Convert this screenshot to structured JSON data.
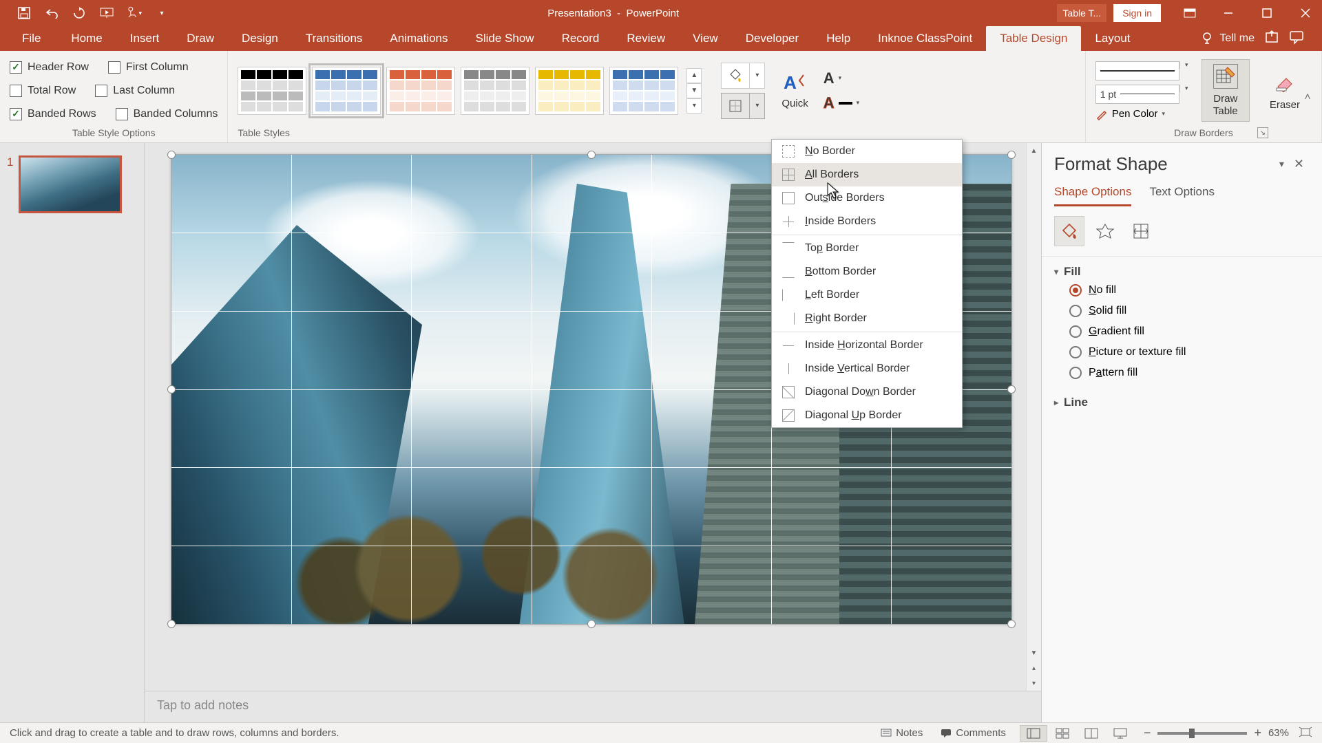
{
  "title": {
    "doc": "Presentation3",
    "app": "PowerPoint",
    "tool_tab": "Table T..."
  },
  "signin": "Sign in",
  "tabs": [
    "File",
    "Home",
    "Insert",
    "Draw",
    "Design",
    "Transitions",
    "Animations",
    "Slide Show",
    "Record",
    "Review",
    "View",
    "Developer",
    "Help",
    "Inknoe ClassPoint",
    "Table Design",
    "Layout"
  ],
  "tellme": "Tell me",
  "style_options": {
    "header_row": "Header Row",
    "total_row": "Total Row",
    "banded_rows": "Banded Rows",
    "first_column": "First Column",
    "last_column": "Last Column",
    "banded_columns": "Banded Columns",
    "group": "Table Style Options"
  },
  "table_styles_group": "Table Styles",
  "quick": "Quick",
  "draw_borders": {
    "pen_weight": "1 pt",
    "pen_color": "Pen Color",
    "draw_table": "Draw\nTable",
    "eraser": "Eraser",
    "group": "Draw Borders"
  },
  "borders_menu": {
    "no": "No Border",
    "all": "All Borders",
    "outside": "Outside Borders",
    "inside": "Inside Borders",
    "top": "Top Border",
    "bottom": "Bottom Border",
    "left": "Left Border",
    "right": "Right Border",
    "ins_h": "Inside Horizontal Border",
    "ins_v": "Inside Vertical Border",
    "diag_d": "Diagonal Down Border",
    "diag_u": "Diagonal Up Border"
  },
  "pane": {
    "title": "Format Shape",
    "tabs": {
      "shape": "Shape Options",
      "text": "Text Options"
    },
    "sections": {
      "fill": "Fill",
      "line": "Line"
    },
    "fill_options": {
      "no": "No fill",
      "solid": "Solid fill",
      "gradient": "Gradient fill",
      "picture": "Picture or texture fill",
      "pattern": "Pattern fill"
    }
  },
  "slide_thumb_num": "1",
  "notes_placeholder": "Tap to add notes",
  "status": {
    "left": "Click and drag to create a table and to draw rows, columns and borders.",
    "notes": "Notes",
    "comments": "Comments",
    "zoom_pct": "63%"
  }
}
